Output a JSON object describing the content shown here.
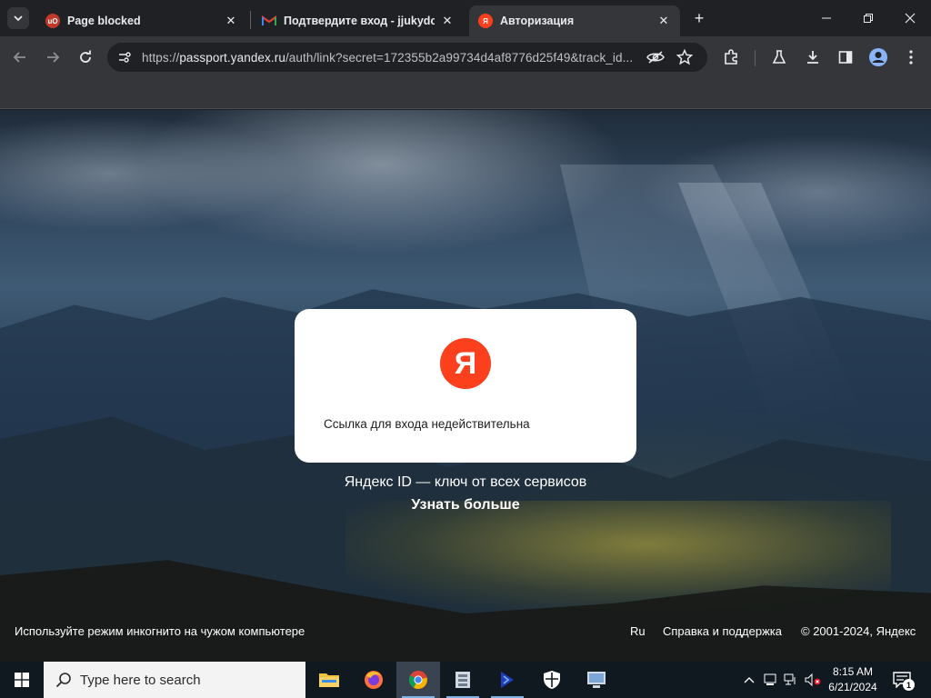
{
  "browser": {
    "tabs": [
      {
        "title": "Page blocked",
        "favicon": "ublock-origin-icon",
        "favicon_text": "uO",
        "favicon_color": "#c0392b",
        "active": false
      },
      {
        "title": "Подтвердите вход - jjukydoo",
        "favicon": "gmail-icon",
        "favicon_text": "M",
        "favicon_color": "#ea4335",
        "active": false
      },
      {
        "title": "Авторизация",
        "favicon": "yandex-icon",
        "favicon_text": "Я",
        "favicon_color": "#fc3f1d",
        "active": true
      }
    ],
    "url_prefix": "https://",
    "url_host": "passport.yandex.ru",
    "url_path": "/auth/link?secret=172355b2a99734d4af8776d25f49&track_id..."
  },
  "page": {
    "logo_letter": "Я",
    "message": "Ссылка для входа недействительна",
    "tagline": "Яндекс ID — ключ от всех сервисов",
    "learn_more": "Узнать больше",
    "footer": {
      "incognito_hint": "Используйте режим инкогнито на чужом компьютере",
      "language": "Ru",
      "help": "Справка и поддержка",
      "copyright": "© 2001-2024, Яндекс"
    }
  },
  "taskbar": {
    "search_placeholder": "Type here to search",
    "time": "8:15 AM",
    "date": "6/21/2024",
    "notification_count": "1",
    "apps": [
      "file-explorer-icon",
      "firefox-icon",
      "chrome-icon",
      "archive-app-icon",
      "terminal-app-icon",
      "security-shield-icon",
      "remote-app-icon"
    ]
  },
  "colors": {
    "yandex_red": "#fc3f1d",
    "chrome_dark": "#202124",
    "toolbar": "#35363a"
  }
}
